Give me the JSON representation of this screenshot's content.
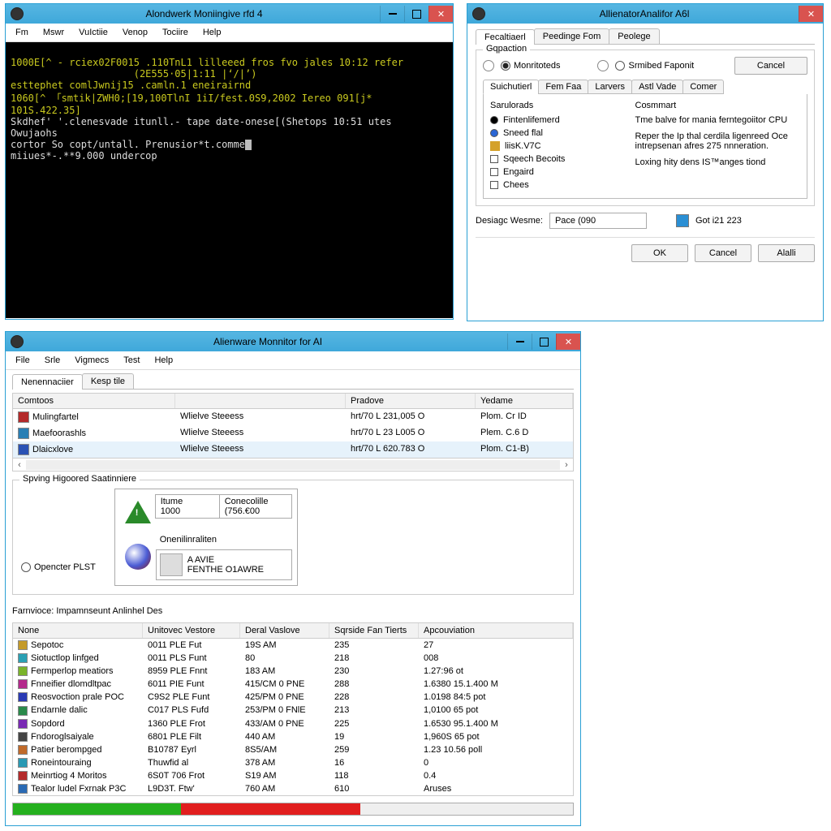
{
  "win1": {
    "title": "Alondwerk Moniingive rfd 4",
    "menu": [
      "Fm",
      "Mswr",
      "VuIctiie",
      "Venop",
      "Tociire",
      "Help"
    ],
    "lines": [
      "1000E[^ - rciex02F0015 .110TnL1 lilleeed fros fvo jales 10:12 refer",
      "                     (2E555·05|1:11 |‘/|’)",
      "esttephet comlJwnij15 .camln.1 eneirairnd",
      "1060[^ 「smtik|ZWH0;[19,100TlnI 1iI/fest.0S9,2002 Iereo 091[j* 101S.422.35]",
      "Skdhef' '.clenesvade itunll.- tape date-onese[(Shetops 10:51 utes",
      "Owujaohs",
      "cortor So copt/untall. Prenusior*t.comme",
      "miiues*-.**9.000 undercop"
    ]
  },
  "win2": {
    "title": "AllienatorAnalifor A6l",
    "tabs": [
      "Fecaltiaerl",
      "Peedinge Fom",
      "Peolege"
    ],
    "group_legend": "Gqpaction",
    "radio_monitor": "Monritoteds",
    "radio_report": "Srmibed Faponit",
    "cancel": "Cancel",
    "subtabs": [
      "Suichutierl",
      "Fem Faa",
      "Larvers",
      "Astl Vade",
      "Comer"
    ],
    "left_legend": "Sarulorads",
    "opts": [
      "Fintenlifemerd",
      "Sneed flal",
      "liisK.V7C",
      "Sqeech Becoits",
      "Engaird",
      "Chees"
    ],
    "right_legend": "Cosmmart",
    "right_text": [
      "Tme balve for mania ferntegoiitor CPU",
      "Reper the Ip thal cerdila ligenreed Oce intrepsenan afres 275 nnneration.",
      "Loxing hity dens IS™anges tiond"
    ],
    "design_label": "Desiagc Wesme:",
    "design_value": "Pace (090",
    "get_btn": "Got i21 223",
    "ok": "OK",
    "cancel2": "Cancel",
    "apply": "Alalli"
  },
  "win3": {
    "title": "Alienware Monnitor for AI",
    "menu": [
      "File",
      "Srle",
      "Vigmecs",
      "Test",
      "Help"
    ],
    "tabs": [
      "Nenennaciier",
      "Kesp tile"
    ],
    "col_headers": [
      "Comtoos",
      "Pradove",
      "Yedame"
    ],
    "rows": [
      {
        "ic": "#B42A2A",
        "name": "Mulingfartel",
        "b": "Wlielve Steeess",
        "c": "hrt/70 L 231,005 O",
        "d": "Plom. Cr ID"
      },
      {
        "ic": "#2a7fb4",
        "name": "Maefoorashls",
        "b": "Wlielve Steeess",
        "c": "hrt/70 L 23 L005 O",
        "d": "Plem. C.6 D"
      },
      {
        "ic": "#2a52b4",
        "name": "Dlaicxlove",
        "b": "Wlielve Steeess",
        "c": "hrt/70 L 620.783 O",
        "d": "Plom. C1-B)"
      }
    ],
    "gb_legend": "Spving Higoored Saatinniere",
    "opencter": "Opencter PLST",
    "panel": {
      "itume_l": "Itume",
      "itume_v": "1000",
      "cone_l": "Conecolille",
      "cone_v": "(756.€00",
      "onen": "Onenilinraliten",
      "aave": "A AVIE",
      "sent": "FENTHE O1AWRE"
    },
    "section2_title": "Farnvioce: Impamnseunt Anlinhel Des",
    "t2_headers": [
      "None",
      "Unitovec Vestore",
      "Deral Vaslove",
      "Sqrside Fan Tierts",
      "Apcouviation"
    ],
    "t2_rows": [
      {
        "ic": "#c49a2a",
        "n": "Sepotoc",
        "u": "0011 PLE Fut",
        "d": "19S AM",
        "s": "235",
        "a": "27"
      },
      {
        "ic": "#2aa0b4",
        "n": "Siotuctlop linfged",
        "u": "0011 PLS Funt",
        "d": "80",
        "s": "218",
        "a": "008"
      },
      {
        "ic": "#7ab42a",
        "n": "Fermperlop meatiors",
        "u": "8959 PLE Fnnt",
        "d": "183 AM",
        "s": "230",
        "a": "1.27:96 ot"
      },
      {
        "ic": "#b42a8c",
        "n": "Fnneifier dlomdltpac",
        "u": "6011 PIE Funt",
        "d": "415/CM 0 PNE",
        "s": "288",
        "a": "1.6380 15.1.400 M"
      },
      {
        "ic": "#2a3ab4",
        "n": "Reosvoction prale POC",
        "u": "C9S2 PLE Funt",
        "d": "425/PM 0 PNE",
        "s": "228",
        "a": "1.0198 84:5 pot"
      },
      {
        "ic": "#2a8a4a",
        "n": "Endarnle dalic",
        "u": "C017 PLS Fufd",
        "d": "253/PM 0 FNlE",
        "s": "213",
        "a": "1,0100 65 pot"
      },
      {
        "ic": "#7a2ab4",
        "n": "Sopdord",
        "u": "1360 PLE Frot",
        "d": "433/AM 0 PNE",
        "s": "225",
        "a": "1.6530 95.1.400 M"
      },
      {
        "ic": "#444",
        "n": "Fndoroglsaiyale",
        "u": "6801 PLE Filt",
        "d": "440 AM",
        "s": "19",
        "a": "1,960S 65 pot"
      },
      {
        "ic": "#c06a2a",
        "n": "Patier berompged",
        "u": "B10787 Eyrl",
        "d": "8S5/AM",
        "s": "259",
        "a": "1.23 10.56 poll"
      },
      {
        "ic": "#2a9ab4",
        "n": "Roneintouraing",
        "u": "Thuwfid al",
        "d": "378 AM",
        "s": "16",
        "a": "0"
      },
      {
        "ic": "#b42a2a",
        "n": "Meinrtiog 4 Moritos",
        "u": "6S0T 706 Frot",
        "d": "S19 AM",
        "s": "118",
        "a": "0.4"
      },
      {
        "ic": "#2a6ab4",
        "n": "Tealor ludel Fxrnak P3C",
        "u": "L9D3T. Ftw'",
        "d": "760 AM",
        "s": "610",
        "a": "Aruses"
      }
    ],
    "pbar": {
      "green": 30,
      "red": 32
    }
  }
}
